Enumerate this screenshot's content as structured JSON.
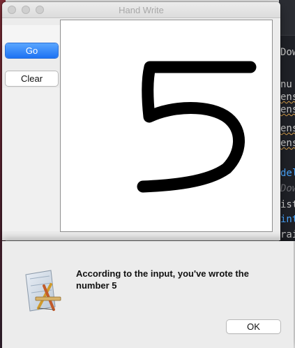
{
  "window": {
    "title": "Hand Write"
  },
  "toolbar": {
    "go_label": "Go",
    "clear_label": "Clear"
  },
  "canvas": {
    "drawn_digit_description": "handwritten digit 5"
  },
  "alert": {
    "message": "According to the input, you've wrote the number 5",
    "ok_label": "OK",
    "icon": "app-icon"
  },
  "background_editor": {
    "lines": [
      "Dow",
      "nu",
      "ens",
      "ens",
      "ens",
      "ens",
      "del",
      "Dow",
      "ist",
      "int",
      "rai"
    ]
  },
  "colors": {
    "accent": "#1d72f3",
    "stroke": "#000000"
  }
}
